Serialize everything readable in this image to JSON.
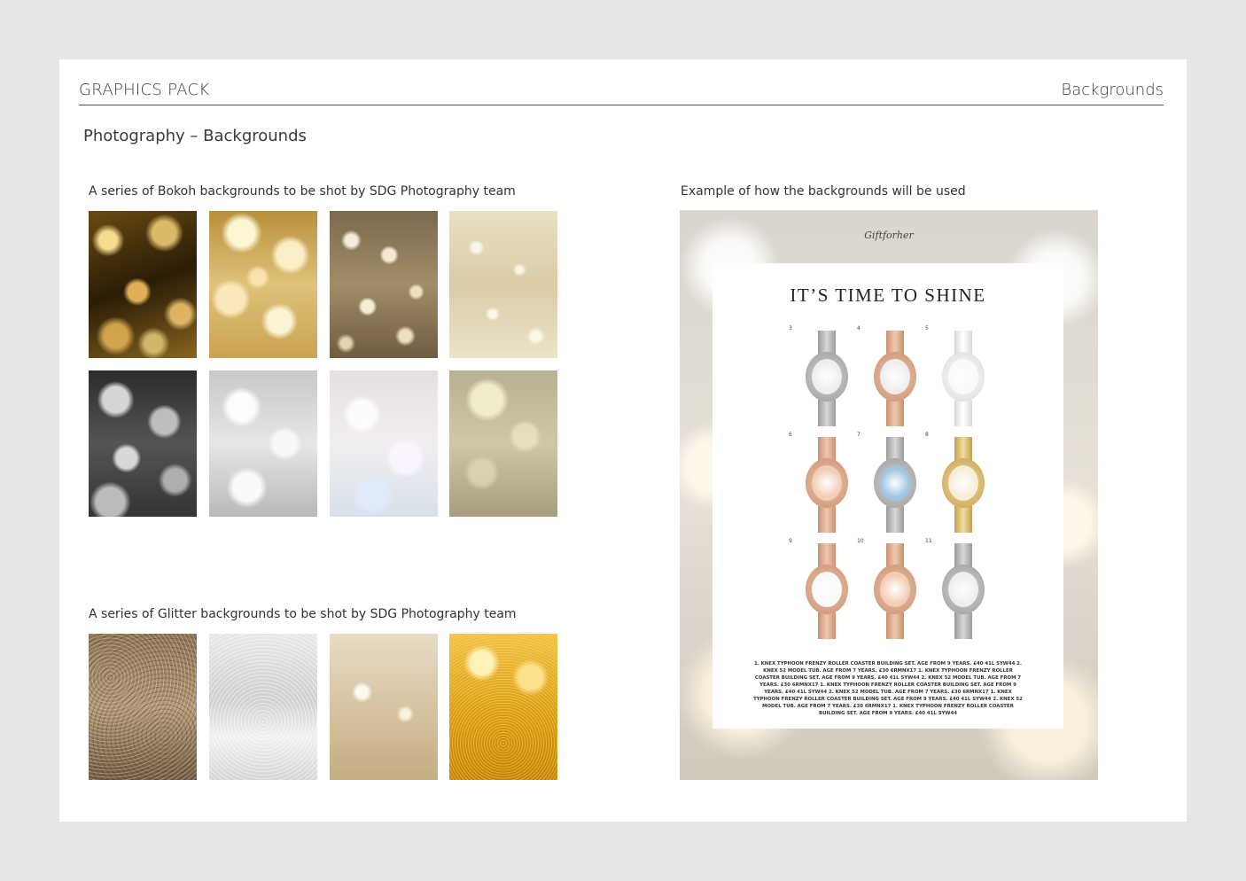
{
  "header": {
    "left_title": "GRAPHICS PACK",
    "right_title": "Backgrounds"
  },
  "subtitle": "Photography – Backgrounds",
  "bokeh": {
    "caption": "A series of Bokoh backgrounds to be shot by SDG Photography team"
  },
  "glitter": {
    "caption": "A series of Glitter backgrounds to be shot by SDG Photography team"
  },
  "example": {
    "caption": "Example of how the backgrounds will be used",
    "brand": "Giftforher",
    "title": "IT’S TIME TO SHINE",
    "watches": [
      {
        "num": "3",
        "metal": "silver",
        "dial": "silver"
      },
      {
        "num": "4",
        "metal": "rose",
        "dial": "silver"
      },
      {
        "num": "5",
        "metal": "white",
        "dial": "white"
      },
      {
        "num": "6",
        "metal": "rose",
        "dial": "rose"
      },
      {
        "num": "7",
        "metal": "silver",
        "dial": "blue"
      },
      {
        "num": "8",
        "metal": "gold",
        "dial": "cream"
      },
      {
        "num": "9",
        "metal": "rose",
        "dial": "white"
      },
      {
        "num": "10",
        "metal": "rose",
        "dial": "rose"
      },
      {
        "num": "11",
        "metal": "silver",
        "dial": "silver"
      }
    ],
    "fine_print": "1. KNEX TYPHOON FRENZY ROLLER COASTER BUILDING SET. AGE FROM 9 YEARS. £40 41L SYW44 2. KNEX 52 MODEL TUB. AGE FROM 7 YEARS. £30 6RMNX17 1. KNEX TYPHOON FRENZY ROLLER COASTER BUILDING SET. AGE FROM 9 YEARS. £40 41L SYW44 2. KNEX 52 MODEL TUB. AGE FROM 7 YEARS. £30 6RMNX17 1. KNEX TYPHOON FRENZY ROLLER COASTER BUILDING SET. AGE FROM 9 YEARS. £40 41L SYW44 2. KNEX 52 MODEL TUB. AGE FROM 7 YEARS. £30 6RMNX17 1. KNEX TYPHOON FRENZY ROLLER COASTER BUILDING SET. AGE FROM 9 YEARS. £40 41L SYW44 2. KNEX 52 MODEL TUB. AGE FROM 7 YEARS. £30 6RMNX17 1. KNEX TYPHOON FRENZY ROLLER COASTER BUILDING SET. AGE FROM 9 YEARS. £40 41L SYW44"
  },
  "colors": {
    "page_bg": "#e6e6e6",
    "card_bg": "#ffffff",
    "rule": "#555555",
    "text": "#3a3a3a"
  }
}
